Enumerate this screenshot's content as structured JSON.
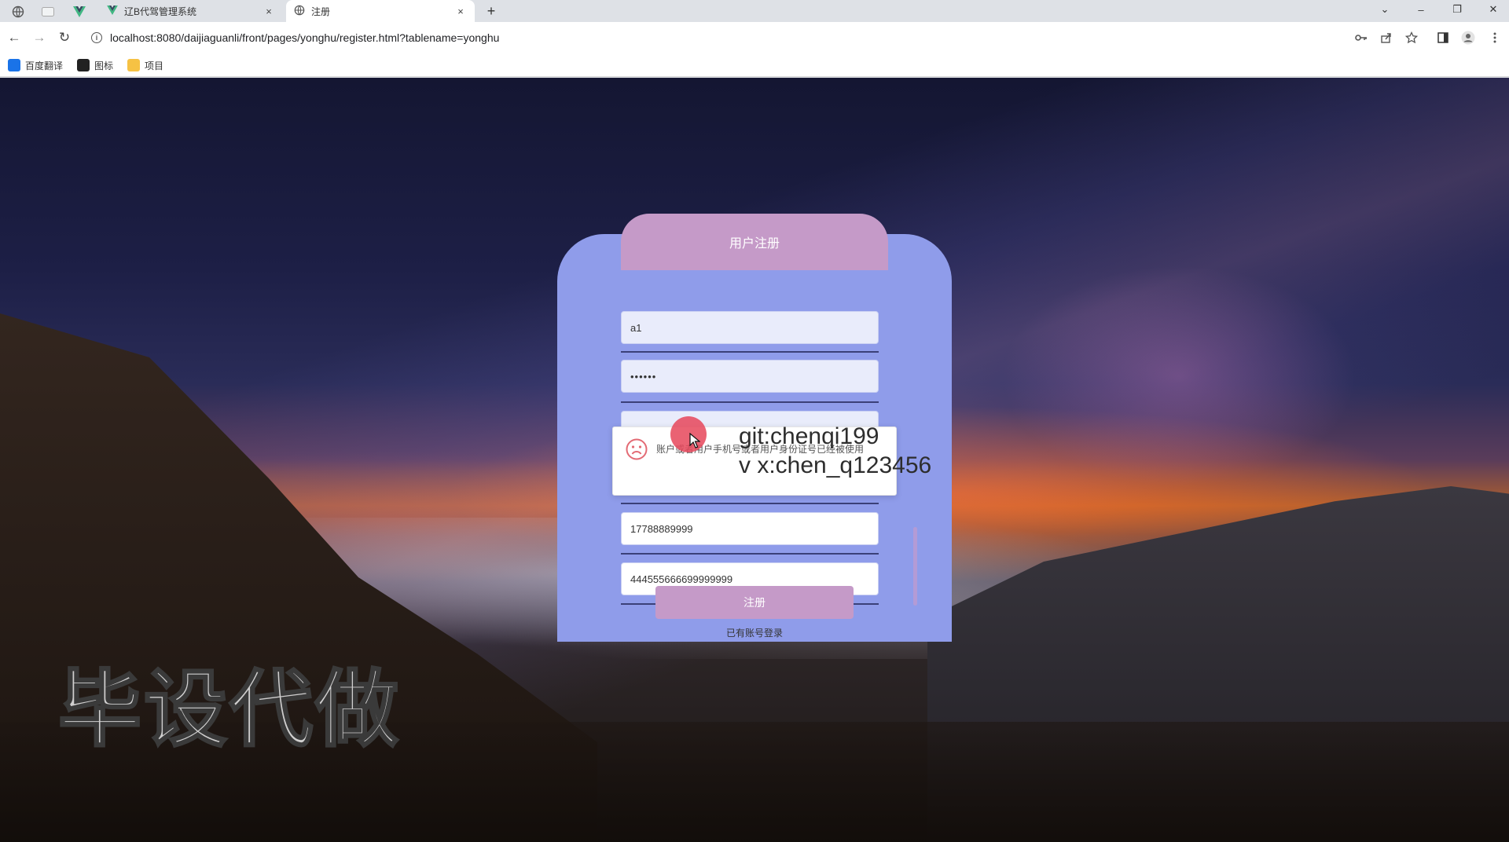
{
  "browser": {
    "tabs": [
      {
        "title": "辽B代驾管理系统",
        "close": "×"
      },
      {
        "title": "注册",
        "close": "×"
      }
    ],
    "new_tab": "+",
    "window_controls": {
      "minimize": "–",
      "restore": "❐",
      "close": "✕",
      "tab_list": "⌄"
    },
    "nav": {
      "back": "←",
      "forward": "→",
      "reload": "↻"
    },
    "url": "localhost:8080/daijiaguanli/front/pages/yonghu/register.html?tablename=yonghu",
    "bookmarks": [
      {
        "label": "百度翻译",
        "icon": "translate-icon",
        "color": "#1a73e8"
      },
      {
        "label": "图标",
        "icon": "image-icon",
        "color": "#222222"
      },
      {
        "label": "项目",
        "icon": "folder-icon",
        "color": "#f6c244"
      }
    ]
  },
  "register": {
    "title": "用户注册",
    "fields": [
      {
        "name": "account",
        "value": "a1"
      },
      {
        "name": "password",
        "value": "••••••"
      },
      {
        "name": "confirm-password",
        "value": ""
      },
      {
        "name": "phone",
        "value": "17788889999"
      },
      {
        "name": "id-number",
        "value": "444555666699999999"
      }
    ],
    "toast_message": "账户或者用户手机号或者用户身份证号已经被使用",
    "submit_label": "注册",
    "login_link": "已有账号登录"
  },
  "overlay": {
    "git": "git:chenqi199",
    "wechat": "v x:chen_q123456",
    "banner": "毕设代做"
  },
  "colors": {
    "panel": "#8f9cea",
    "header": "#c59ac8",
    "button": "#c59ac8",
    "cursor_highlight": "#e6465a"
  }
}
